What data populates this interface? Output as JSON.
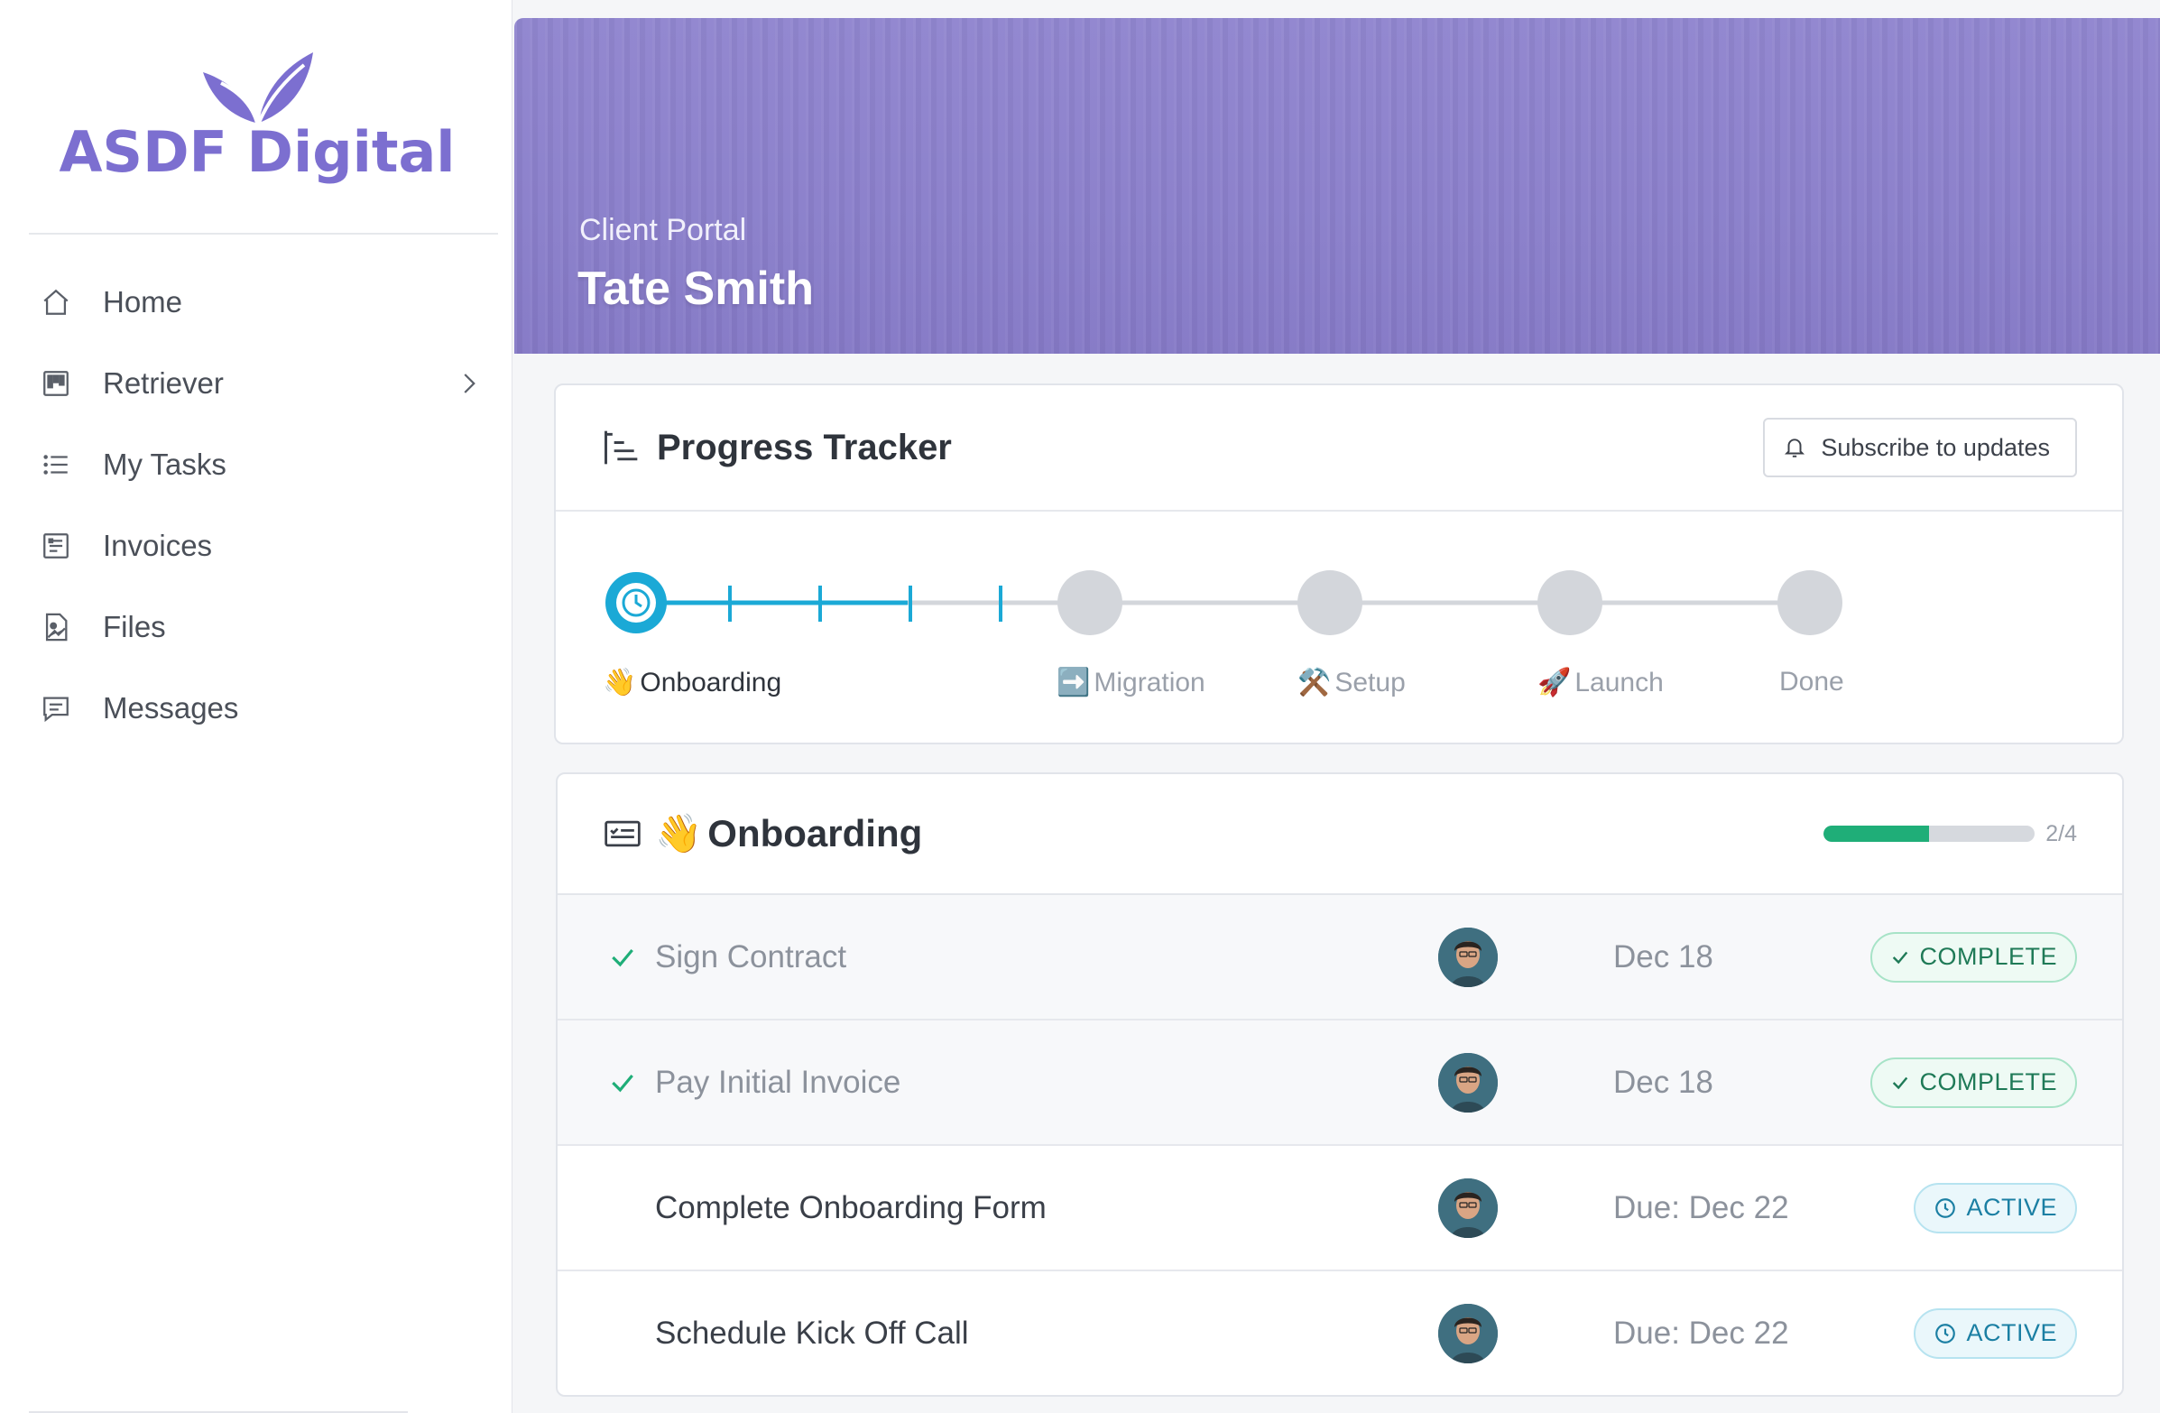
{
  "brand": {
    "name": "ASDF Digital",
    "color": "#7c6fd0"
  },
  "sidebar": {
    "items": [
      {
        "label": "Home",
        "icon": "home-icon"
      },
      {
        "label": "Retriever",
        "icon": "board-icon",
        "has_submenu": true
      },
      {
        "label": "My Tasks",
        "icon": "list-icon"
      },
      {
        "label": "Invoices",
        "icon": "invoice-icon"
      },
      {
        "label": "Files",
        "icon": "file-icon"
      },
      {
        "label": "Messages",
        "icon": "message-icon"
      }
    ]
  },
  "header": {
    "subtitle": "Client Portal",
    "title": "Tate Smith"
  },
  "tracker": {
    "title": "Progress Tracker",
    "subscribe_label": "Subscribe to updates",
    "steps": [
      {
        "label": "Onboarding",
        "emoji": "👋",
        "state": "current"
      },
      {
        "label": "Migration",
        "emoji": "➡️",
        "state": "pending"
      },
      {
        "label": "Setup",
        "emoji": "⚒️",
        "state": "pending"
      },
      {
        "label": "Launch",
        "emoji": "🚀",
        "state": "pending"
      },
      {
        "label": "Done",
        "emoji": "",
        "state": "pending"
      }
    ],
    "accent": "#1ba9d6"
  },
  "onboarding": {
    "title": "Onboarding",
    "emoji": "👋",
    "progress_text": "2/4",
    "progress_fraction": 0.5,
    "tasks": [
      {
        "name": "Sign Contract",
        "date": "Dec 18",
        "status": "COMPLETE",
        "done": true
      },
      {
        "name": "Pay Initial Invoice",
        "date": "Dec 18",
        "status": "COMPLETE",
        "done": true
      },
      {
        "name": "Complete Onboarding Form",
        "date": "Due: Dec 22",
        "status": "ACTIVE",
        "done": false
      },
      {
        "name": "Schedule Kick Off Call",
        "date": "Due: Dec 22",
        "status": "ACTIVE",
        "done": false
      }
    ]
  }
}
